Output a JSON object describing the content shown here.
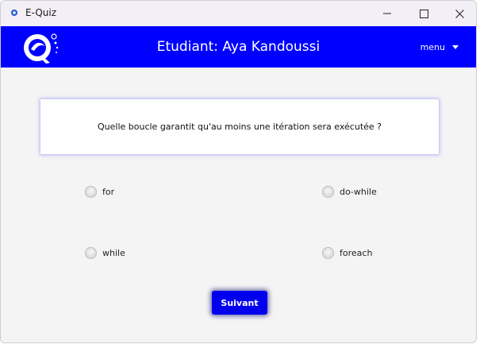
{
  "window": {
    "title": "E-Quiz",
    "controls": {
      "minimize_icon": "minimize-icon",
      "maximize_icon": "maximize-icon",
      "close_icon": "close-icon"
    }
  },
  "header": {
    "background_color": "#0000ff",
    "logo_icon": "quiz-logo-icon",
    "student_label": "Etudiant: Aya Kandoussi",
    "menu_label": "menu",
    "menu_icon": "chevron-down-icon"
  },
  "question": {
    "text": "Quelle boucle garantit qu'au moins une itération sera exécutée ?"
  },
  "answers": [
    {
      "label": "for",
      "selected": false
    },
    {
      "label": "do-while",
      "selected": false
    },
    {
      "label": "while",
      "selected": false
    },
    {
      "label": "foreach",
      "selected": false
    }
  ],
  "actions": {
    "next_label": "Suivant",
    "next_color": "#0000ee"
  }
}
